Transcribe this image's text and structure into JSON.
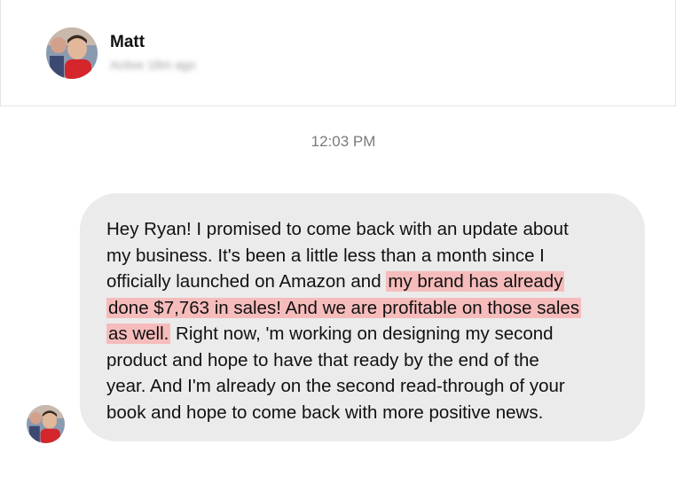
{
  "header": {
    "contact_name": "Matt",
    "contact_status": "Active 18m ago"
  },
  "conversation": {
    "timestamp": "12:03 PM",
    "message": {
      "before": "Hey Ryan! I promised to come back with an update about\nmy business. It's been a little less than a month since I\nofficially launched on Amazon and ",
      "highlight_1": "my brand has already",
      "highlight_2": "done $7,763 in sales! And we are profitable on those sales",
      "highlight_3": "as well.",
      "after": " Right now, 'm working on designing my second\nproduct and hope to have that ready by the end of the\nyear. And I'm already on the second read-through of your\nbook and hope to come back with more positive news."
    }
  },
  "colors": {
    "bubble_background": "#ebebeb",
    "highlight": "#f6bcbc",
    "header_border": "#e4e4e4"
  }
}
